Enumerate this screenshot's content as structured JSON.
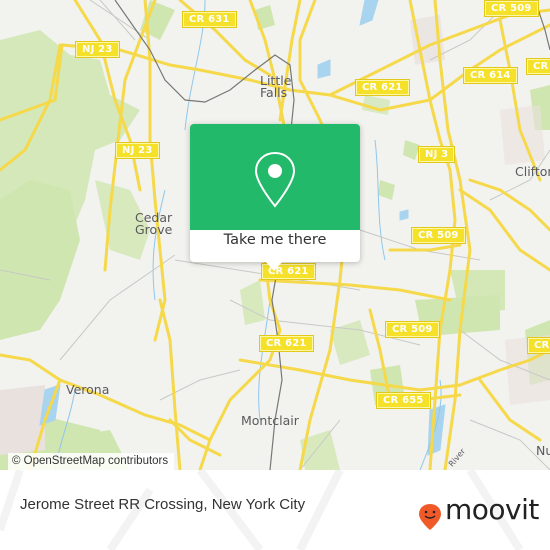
{
  "map": {
    "route_shields": [
      {
        "id": "cr631",
        "label": "CR 631"
      },
      {
        "id": "cr509-top",
        "label": "CR 509"
      },
      {
        "id": "nj23-top",
        "label": "NJ 23"
      },
      {
        "id": "cr614",
        "label": "CR 614"
      },
      {
        "id": "cr621-top",
        "label": "CR 621"
      },
      {
        "id": "nj23-mid",
        "label": "NJ 23"
      },
      {
        "id": "nj3",
        "label": "NJ 3"
      },
      {
        "id": "cr509-mid",
        "label": "CR 509"
      },
      {
        "id": "cr621-popup",
        "label": "CR 621"
      },
      {
        "id": "cr509-low",
        "label": "CR 509"
      },
      {
        "id": "cr621-low",
        "label": "CR 621"
      },
      {
        "id": "cr655",
        "label": "CR 655"
      }
    ],
    "places": [
      {
        "id": "little-falls",
        "label": "Little\nFalls"
      },
      {
        "id": "cedar-grove",
        "label": "Cedar\nGrove"
      },
      {
        "id": "clifton",
        "label": "Clifton"
      },
      {
        "id": "verona",
        "label": "Verona"
      },
      {
        "id": "montclair",
        "label": "Montclair"
      },
      {
        "id": "nutley",
        "label": "Nu"
      }
    ],
    "water_label": "River",
    "attribution": "© OpenStreetMap contributors"
  },
  "popup": {
    "icon": "map-pin-icon",
    "action_label": "Take me there",
    "color": "#23b96a"
  },
  "footer": {
    "location_title": "Jerome Street RR Crossing, New York City",
    "brand": "moovit",
    "brand_color": "#f05a28"
  }
}
